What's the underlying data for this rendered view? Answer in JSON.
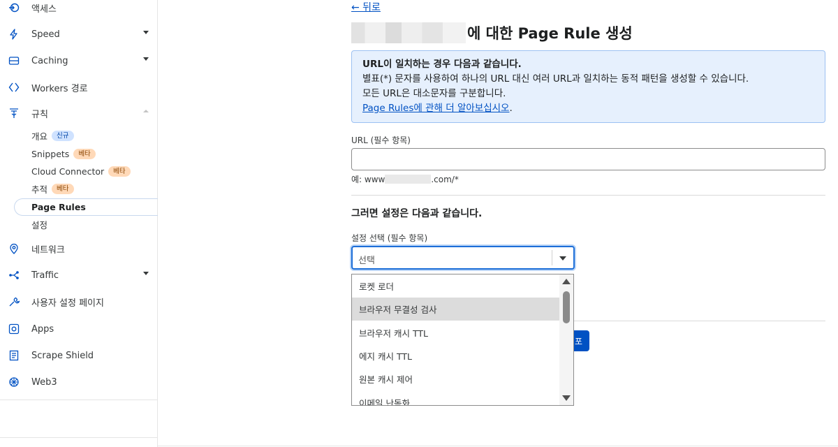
{
  "sidebar": {
    "items": [
      {
        "label": "액세스",
        "icon": "access-icon"
      },
      {
        "label": "Speed",
        "icon": "lightning-icon",
        "caret": "down"
      },
      {
        "label": "Caching",
        "icon": "caching-icon",
        "caret": "down"
      },
      {
        "label": "Workers 경로",
        "icon": "workers-icon"
      },
      {
        "label": "규칙",
        "icon": "rules-icon",
        "caret": "up"
      },
      {
        "label": "네트워크",
        "icon": "location-pin-icon"
      },
      {
        "label": "Traffic",
        "icon": "traffic-icon",
        "caret": "down"
      },
      {
        "label": "사용자 설정 페이지",
        "icon": "wrench-icon"
      },
      {
        "label": "Apps",
        "icon": "apps-icon"
      },
      {
        "label": "Scrape Shield",
        "icon": "document-icon"
      },
      {
        "label": "Web3",
        "icon": "web3-icon"
      }
    ],
    "sub_items": [
      {
        "label": "개요",
        "badge": "신규"
      },
      {
        "label": "Snippets",
        "badge": "베타"
      },
      {
        "label": "Cloud Connector",
        "badge": "베타"
      },
      {
        "label": "추적",
        "badge": "베타"
      },
      {
        "label": "Page Rules",
        "active": true
      },
      {
        "label": "설정"
      }
    ]
  },
  "main": {
    "back_label": "← 뒤로",
    "title": "에 대한 Page Rule 생성",
    "info": {
      "heading": "URL이 일치하는 경우 다음과 같습니다.",
      "line1": "별표(*) 문자를 사용하여 하나의 URL 대신 여러 URL과 일치하는 동적 패턴을 생성할 수 있습니다.",
      "line2": "모든 URL은 대소문자를 구분합니다.",
      "link": "Page Rules에 관해 더 알아보십시오",
      "link_suffix": "."
    },
    "url_label": "URL (필수 항목)",
    "url_value": "",
    "hint_prefix": "예: www",
    "hint_suffix": ".com/*",
    "section_title": "그러면 설정은 다음과 같습니다.",
    "select_label": "설정 선택 (필수 항목)",
    "select_value": "선택",
    "options": [
      "로켓 로더",
      "브라우저 무결성 검사",
      "브라우저 캐시 TTL",
      "에지 캐시 TTL",
      "원본 캐시 제어",
      "이메일 난독화"
    ],
    "highlighted_option": 1,
    "button_fragment": "포"
  },
  "colors": {
    "accent": "#0051c3",
    "info_bg": "#e6f0fd",
    "badge_new": "#cfe2ff",
    "badge_beta": "#ffd9b8"
  }
}
